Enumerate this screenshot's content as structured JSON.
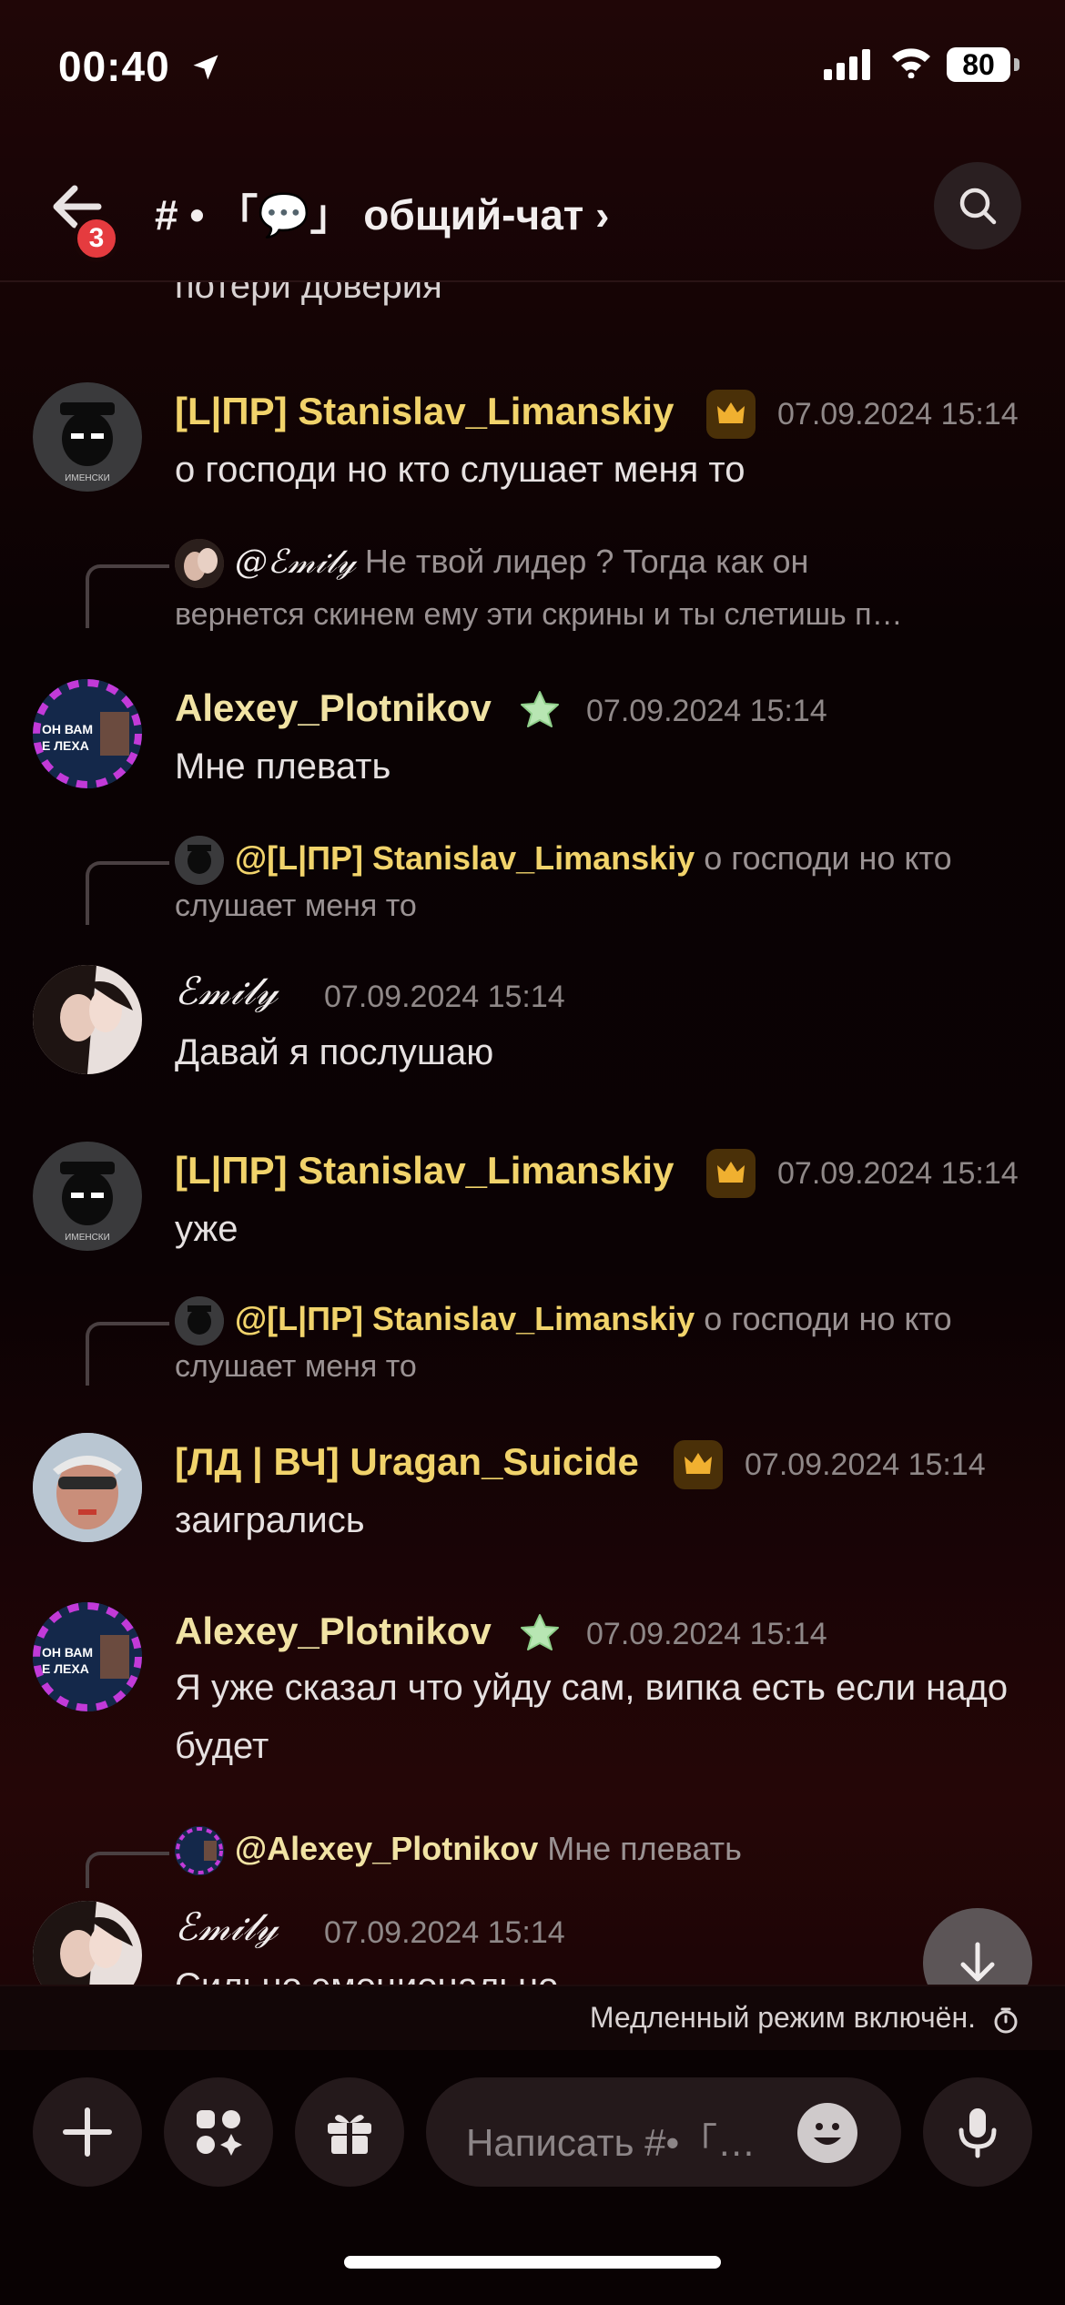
{
  "status_bar": {
    "time": "00:40",
    "battery": "80"
  },
  "header": {
    "unread_badge": "3",
    "channel_title": "# • 「💬」 общий-чат ›"
  },
  "colors": {
    "accent_name": "#f1d36b",
    "timestamp": "#8f8888"
  },
  "messages": {
    "continuation_text": "потери доверия",
    "m1": {
      "author": "[L|ПР] Stanislav_Limanskiy",
      "time": "07.09.2024 15:14",
      "text": "о господи но кто слушает меня то"
    },
    "m2": {
      "reply_mention": "@ℰ𝓂𝒾𝓁𝓎",
      "reply_snippet": "Не твой лидер ? Тогда как он",
      "reply_snippet2": "вернется скинем ему эти скрины и ты слетишь п…",
      "author": "Alexey_Plotnikov",
      "time": "07.09.2024 15:14",
      "text": "Мне плевать"
    },
    "m3": {
      "reply_mention": "@[L|ПР] Stanislav_Limanskiy",
      "reply_snippet": "о господи но кто",
      "reply_snippet2": "слушает меня то",
      "author": "ℰ𝓂𝒾𝓁𝓎",
      "time": "07.09.2024 15:14",
      "text": "Давай я послушаю"
    },
    "m4": {
      "author": "[L|ПР] Stanislav_Limanskiy",
      "time": "07.09.2024 15:14",
      "text": "уже"
    },
    "m5": {
      "reply_mention": "@[L|ПР] Stanislav_Limanskiy",
      "reply_snippet": "о господи но кто",
      "reply_snippet2": "слушает меня то",
      "author": "[ЛД | ВЧ] Uragan_Suicide",
      "time": "07.09.2024 15:14",
      "text": "заигрались"
    },
    "m6": {
      "author": "Alexey_Plotnikov",
      "time": "07.09.2024 15:14",
      "text": "Я уже сказал что уйду сам, випка есть если надо будет"
    },
    "m7": {
      "reply_mention": "@Alexey_Plotnikov",
      "reply_snippet": "Мне плевать",
      "author": "ℰ𝓂𝒾𝓁𝓎",
      "time": "07.09.2024 15:14",
      "text": "Сильно эмоционально ."
    },
    "avatar_text": {
      "stanislav": "ИМЕНСКИ",
      "alexey_l1": "ОН ВАМ",
      "alexey_l2": "Е ЛЕХА"
    }
  },
  "slowmode": {
    "text": "Медленный режим включён."
  },
  "composer": {
    "placeholder": "Написать #•「…"
  }
}
